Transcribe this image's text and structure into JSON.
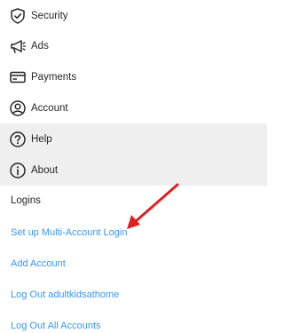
{
  "menu": {
    "items": [
      {
        "label": "Security",
        "icon": "shield-check-icon"
      },
      {
        "label": "Ads",
        "icon": "megaphone-icon"
      },
      {
        "label": "Payments",
        "icon": "credit-card-icon"
      },
      {
        "label": "Account",
        "icon": "account-icon"
      },
      {
        "label": "Help",
        "icon": "help-icon"
      },
      {
        "label": "About",
        "icon": "info-icon"
      }
    ]
  },
  "logins": {
    "title": "Logins",
    "links": [
      "Set up Multi-Account Login",
      "Add Account",
      "Log Out adultkidsathome",
      "Log Out All Accounts"
    ]
  },
  "colors": {
    "link": "#3897f0",
    "highlight_bg": "#efefef",
    "annotation_arrow": "#e02020"
  }
}
